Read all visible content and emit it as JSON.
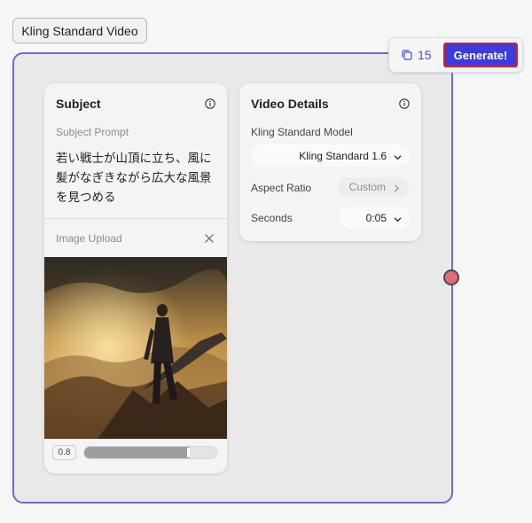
{
  "node": {
    "title": "Kling Standard Video"
  },
  "toolbar": {
    "credits": "15",
    "generate_label": "Generate!"
  },
  "subject": {
    "title": "Subject",
    "prompt_label": "Subject Prompt",
    "prompt_text": "若い戦士が山頂に立ち、風に髪がなぎきながら広大な風景を見つめる",
    "upload_label": "Image Upload",
    "image_description": "warrior standing on mountain peak with windblown cape at sunset",
    "strength_label": "0.8",
    "strength_value": 0.8
  },
  "video_details": {
    "title": "Video Details",
    "model_label": "Kling Standard Model",
    "model_value": "Kling Standard 1.6",
    "aspect_label": "Aspect Ratio",
    "aspect_value": "Custom",
    "seconds_label": "Seconds",
    "seconds_value": "0:05"
  },
  "colors": {
    "accent": "#3b3be0",
    "frame_border": "#6b6bd6",
    "highlight_border": "#d6202a",
    "connector": "#e46a7a"
  }
}
